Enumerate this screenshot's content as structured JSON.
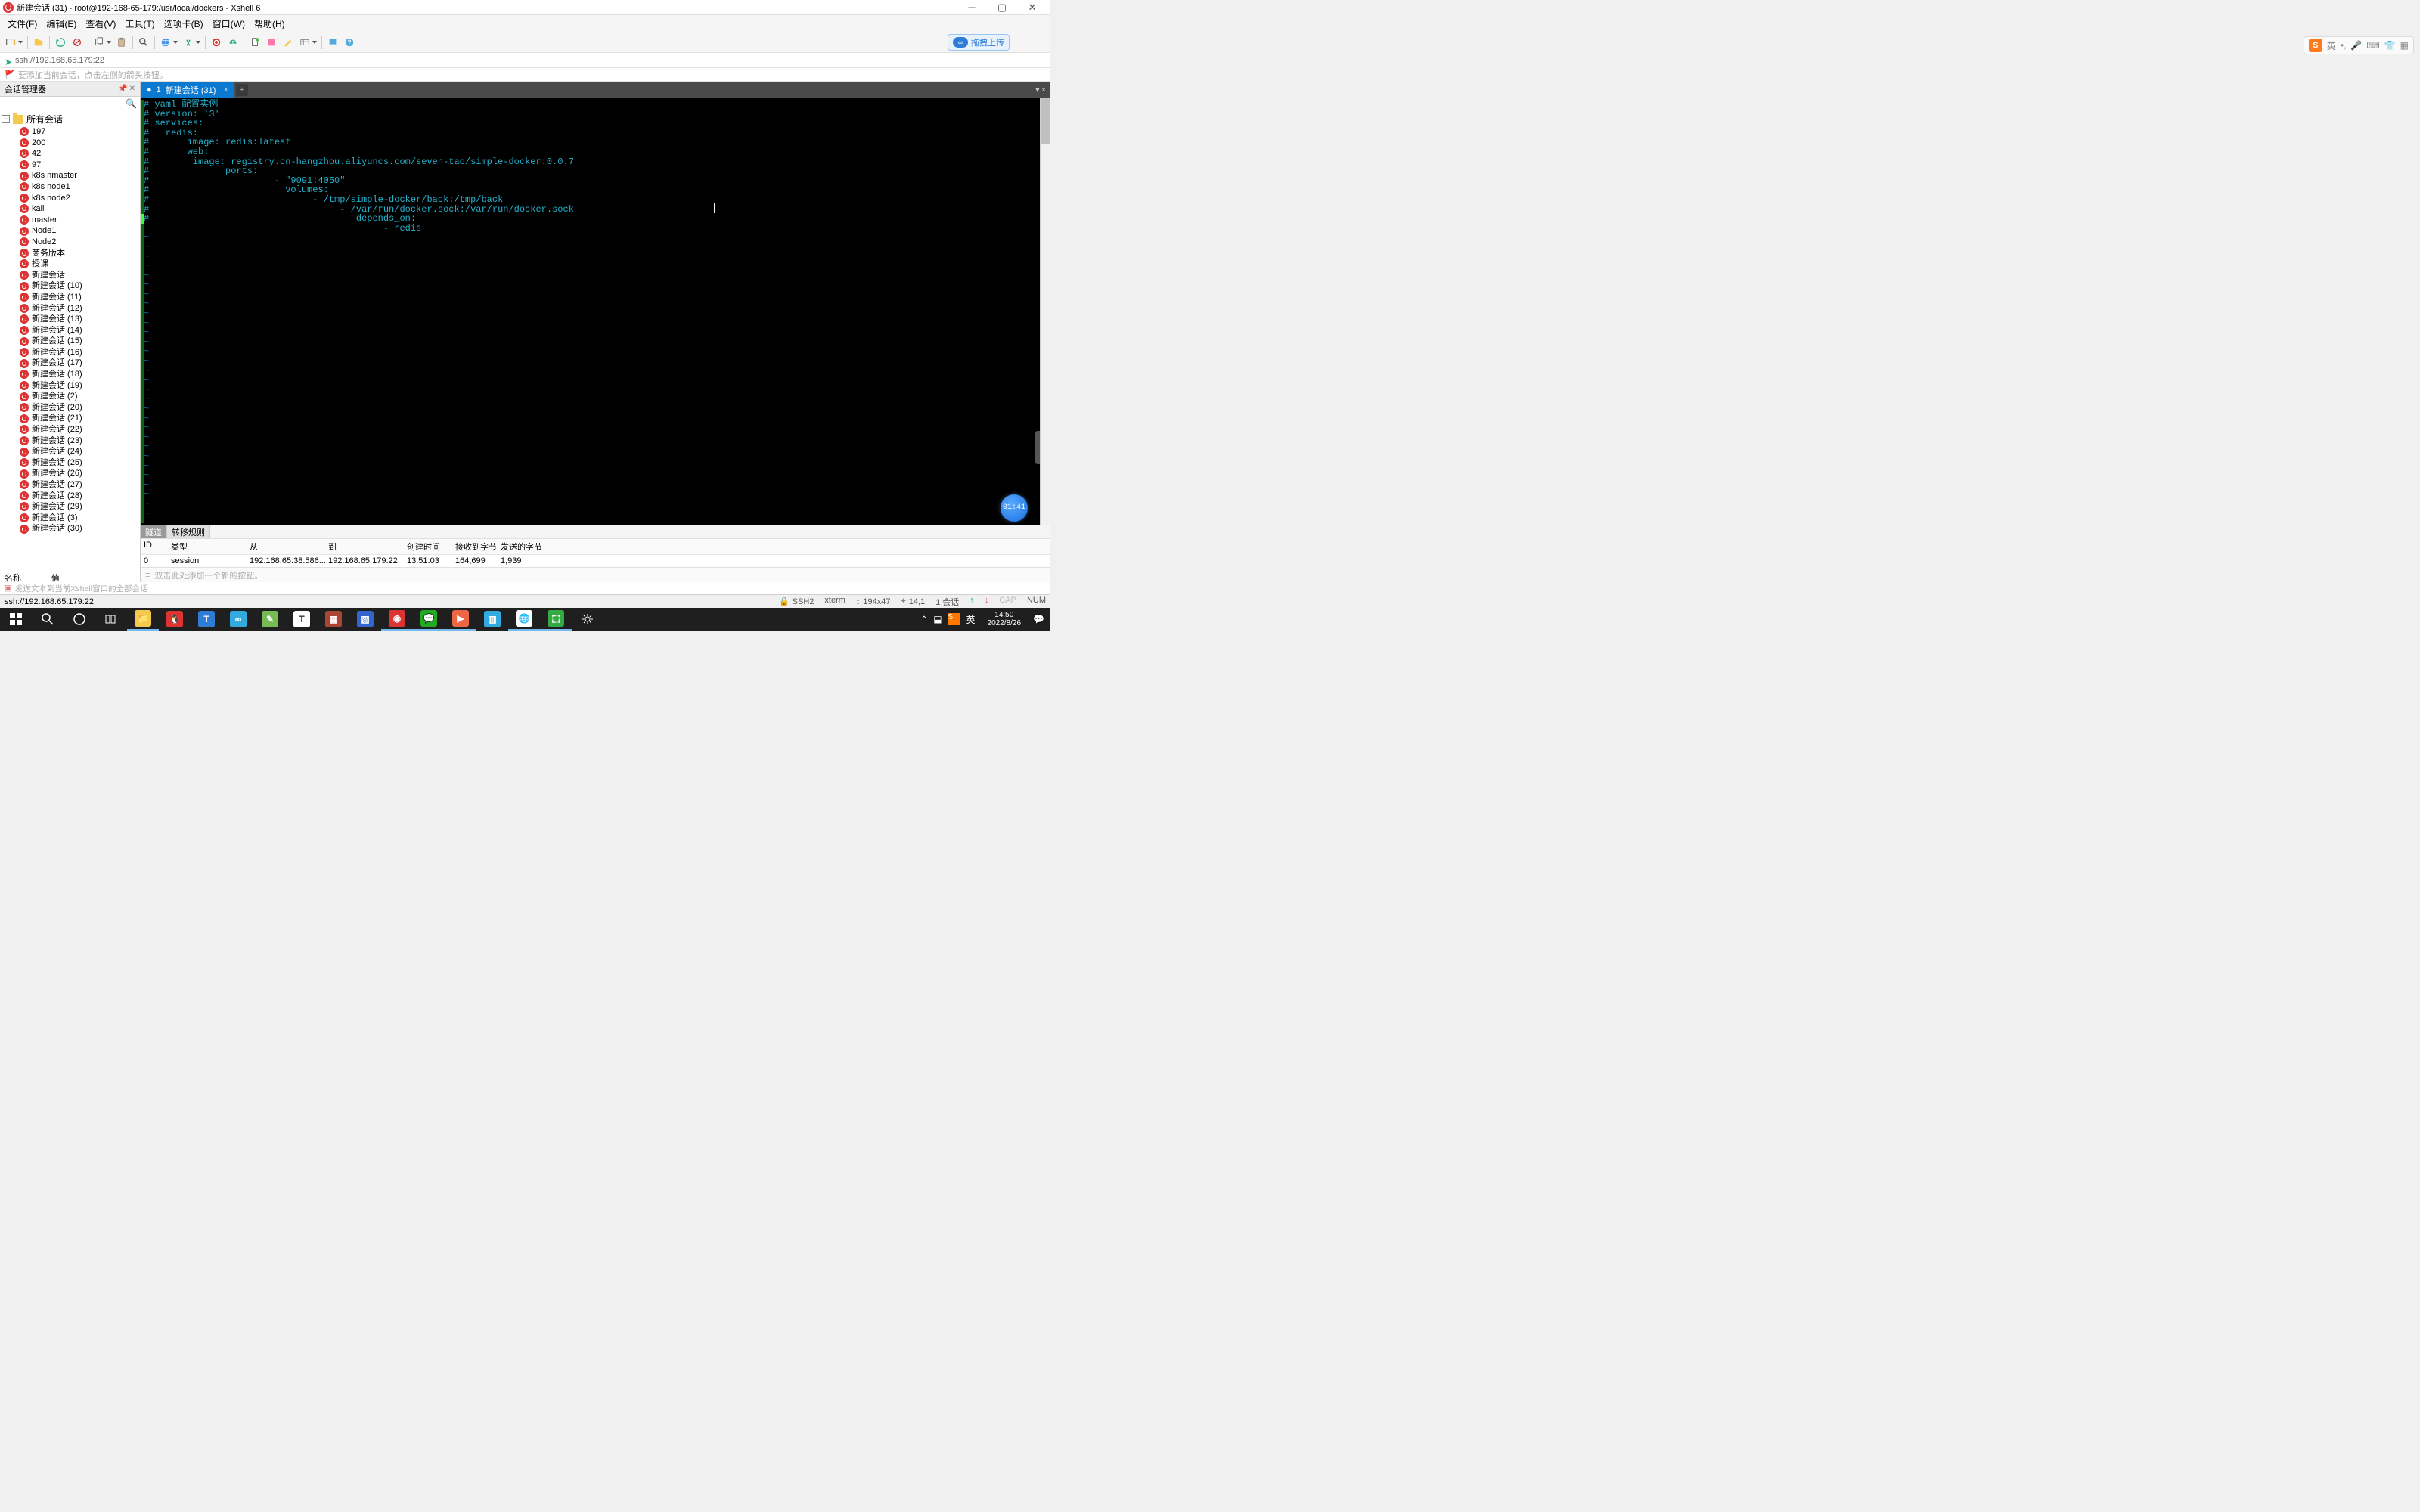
{
  "window": {
    "title": "新建会话 (31) - root@192-168-65-179:/usr/local/dockers - Xshell 6"
  },
  "menu": [
    "文件(F)",
    "编辑(E)",
    "查看(V)",
    "工具(T)",
    "选项卡(B)",
    "窗口(W)",
    "帮助(H)"
  ],
  "toolbar": {
    "upload_label": "拖拽上传",
    "ime_lang": "英",
    "ime_punct": "·,",
    "ime_mode1": "•)",
    "ime_kbd": "⌨",
    "ime_cfg": "⚙"
  },
  "addressbar": {
    "value": "ssh://192.168.65.179:22"
  },
  "hint": "要添加当前会话，点击左侧的箭头按钮。",
  "session_manager": {
    "title": "会话管理器",
    "root": "所有会话",
    "items": [
      "197",
      "200",
      "42",
      "97",
      "k8s nmaster",
      "k8s node1",
      "k8s node2",
      "kali",
      "master",
      "Node1",
      "Node2",
      "商务版本",
      "授课",
      "新建会话",
      "新建会话 (10)",
      "新建会话 (11)",
      "新建会话 (12)",
      "新建会话 (13)",
      "新建会话 (14)",
      "新建会话 (15)",
      "新建会话 (16)",
      "新建会话 (17)",
      "新建会话 (18)",
      "新建会话 (19)",
      "新建会话 (2)",
      "新建会话 (20)",
      "新建会话 (21)",
      "新建会话 (22)",
      "新建会话 (23)",
      "新建会话 (24)",
      "新建会话 (25)",
      "新建会话 (26)",
      "新建会话 (27)",
      "新建会话 (28)",
      "新建会话 (29)",
      "新建会话 (3)",
      "新建会话 (30)"
    ],
    "props_name": "名称",
    "props_value": "值"
  },
  "tabs": {
    "active": {
      "index": "1",
      "label": "新建会话 (31)"
    }
  },
  "terminal": {
    "lines": [
      "# yaml 配置实例",
      "# version: '3'",
      "# services:",
      "#   redis:",
      "#       image: redis:latest",
      "#       web:",
      "#        image: registry.cn-hangzhou.aliyuncs.com/seven-tao/simple-docker:0.0.7",
      "#              ports:",
      "#                       - \"9091:4050\"",
      "#                         volumes:",
      "#                              - /tmp/simple-docker/back:/tmp/back",
      "#                                   - /var/run/docker.sock:/var/run/docker.sock",
      "#                                      depends_on:",
      "                                            - redis"
    ],
    "tilde": "~",
    "timer": "01:41"
  },
  "transfer": {
    "tab1": "隧道",
    "tab2": "转移规则",
    "headers": {
      "id": "ID",
      "type": "类型",
      "from": "从",
      "to": "到",
      "time": "创建时间",
      "rx": "接收到字节",
      "tx": "发送的字节"
    },
    "row": {
      "id": "0",
      "type": "session",
      "from": "192.168.65.38:586...",
      "to": "192.168.65.179:22",
      "time": "13:51:03",
      "rx": "164,699",
      "tx": "1,939"
    }
  },
  "compose": {
    "placeholder": "双击此处添加一个新的按钮。"
  },
  "compose_hint": "发送文本到当前Xshell窗口的全部会话",
  "statusbar": {
    "left": "ssh://192.168.65.179:22",
    "protocol": "SSH2",
    "term": "xterm",
    "size_icon": "⇕",
    "size": "194x47",
    "cursor_icon": "⌖",
    "cursor": "14,1",
    "sess": "1 会话",
    "caps": "CAP",
    "num": "NUM"
  },
  "taskbar": {
    "clock_time": "14:50",
    "clock_date": "2022/8/26",
    "tray_lang": "英",
    "tray_net": "⌃",
    "tray_more": "^"
  }
}
